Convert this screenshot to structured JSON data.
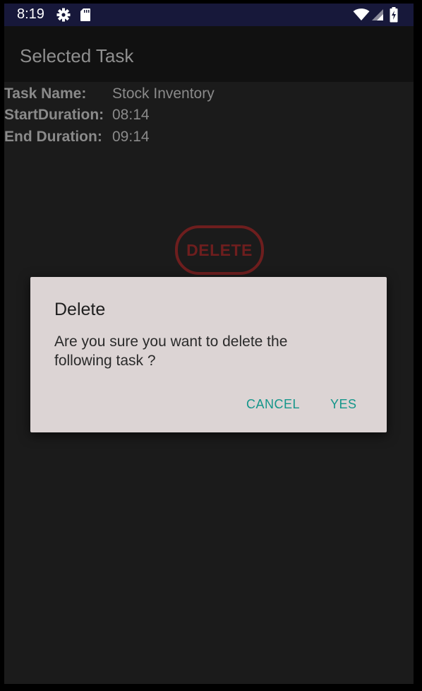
{
  "status_bar": {
    "time": "8:19",
    "icons": [
      "gear-icon",
      "sd-card-icon",
      "wifi-icon",
      "cell-signal-icon",
      "battery-charging-icon"
    ]
  },
  "app_bar": {
    "title": "Selected Task"
  },
  "task_details": [
    {
      "label": "Task Name:",
      "value": "Stock Inventory"
    },
    {
      "label": "StartDuration:",
      "value": "08:14"
    },
    {
      "label": "End Duration:",
      "value": "09:14"
    }
  ],
  "delete_button": {
    "label": "DELETE"
  },
  "dialog": {
    "title": "Delete",
    "message": "Are you sure you want to delete the following task ?",
    "cancel_label": "CANCEL",
    "yes_label": "YES"
  },
  "colors": {
    "status_bar_bg": "#17183a",
    "app_bar_bg": "#111111",
    "background": "#1b1b1b",
    "delete_accent": "#6e1e1e",
    "dialog_bg": "#dcd4d4",
    "dialog_button": "#14968a"
  }
}
